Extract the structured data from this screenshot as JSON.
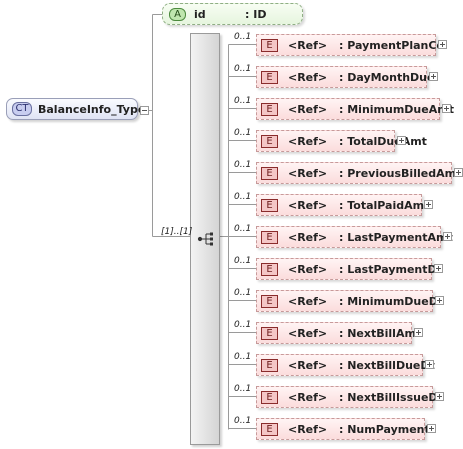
{
  "complex_type": {
    "badge": "CT",
    "name": "BalanceInfo_Type"
  },
  "attribute": {
    "badge": "A",
    "name": "id",
    "type": ": ID"
  },
  "sequence": {
    "occurrence": "[1]..[1]"
  },
  "elements": [
    {
      "occurrence": "0..1",
      "badge": "E",
      "ref": "<Ref>",
      "name": ": PaymentPlanCd"
    },
    {
      "occurrence": "0..1",
      "badge": "E",
      "ref": "<Ref>",
      "name": ": DayMonthDue"
    },
    {
      "occurrence": "0..1",
      "badge": "E",
      "ref": "<Ref>",
      "name": ": MinimumDueAmt"
    },
    {
      "occurrence": "0..1",
      "badge": "E",
      "ref": "<Ref>",
      "name": ": TotalDueAmt"
    },
    {
      "occurrence": "0..1",
      "badge": "E",
      "ref": "<Ref>",
      "name": ": PreviousBilledAmt"
    },
    {
      "occurrence": "0..1",
      "badge": "E",
      "ref": "<Ref>",
      "name": ": TotalPaidAmt"
    },
    {
      "occurrence": "0..1",
      "badge": "E",
      "ref": "<Ref>",
      "name": ": LastPaymentAmt"
    },
    {
      "occurrence": "0..1",
      "badge": "E",
      "ref": "<Ref>",
      "name": ": LastPaymentDt"
    },
    {
      "occurrence": "0..1",
      "badge": "E",
      "ref": "<Ref>",
      "name": ": MinimumDueDt"
    },
    {
      "occurrence": "0..1",
      "badge": "E",
      "ref": "<Ref>",
      "name": ": NextBillAmt"
    },
    {
      "occurrence": "0..1",
      "badge": "E",
      "ref": "<Ref>",
      "name": ": NextBillDueDt"
    },
    {
      "occurrence": "0..1",
      "badge": "E",
      "ref": "<Ref>",
      "name": ": NextBillIssueDt"
    },
    {
      "occurrence": "0..1",
      "badge": "E",
      "ref": "<Ref>",
      "name": ": NumPayments"
    }
  ]
}
